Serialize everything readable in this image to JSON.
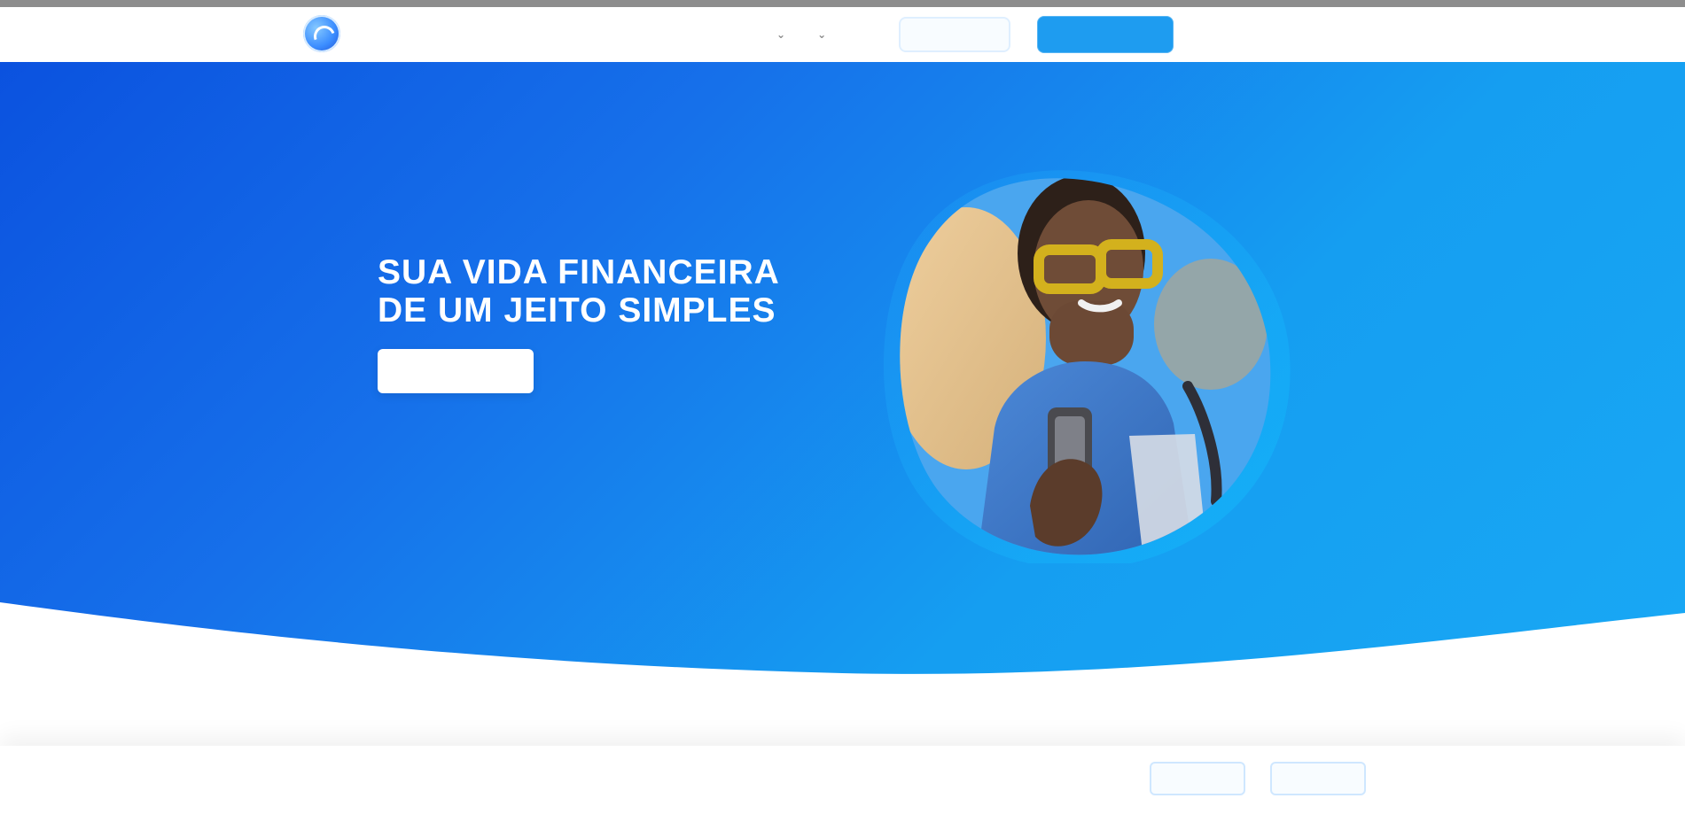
{
  "header": {
    "brand_line_1": "",
    "brand_line_2": "",
    "nav_items": [
      {
        "label": "",
        "icon": "chevron-down-icon"
      },
      {
        "label": "",
        "icon": "chevron-down-icon"
      }
    ],
    "secondary_button": "",
    "primary_button": "",
    "last_link": ""
  },
  "hero": {
    "title": "SUA VIDA FINANCEIRA DE UM JEITO SIMPLES",
    "subtitle": "",
    "cta": ""
  },
  "cookie": {
    "text": "",
    "link": "",
    "buttons": [
      "",
      ""
    ]
  },
  "colors": {
    "hero_start": "#0b52df",
    "hero_end": "#19a8f4",
    "primary": "#1e9cf0",
    "accent": "#47a4ff",
    "white": "#ffffff"
  }
}
